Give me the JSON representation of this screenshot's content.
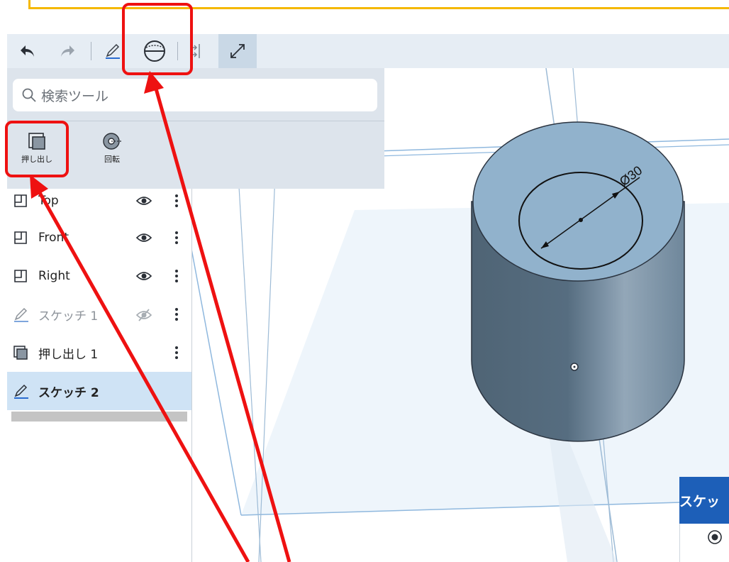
{
  "toolbar": {
    "undo_icon": "undo-icon",
    "redo_icon": "redo-icon",
    "sketch_icon": "pencil-icon",
    "plane_icon": "plane-sphere-icon",
    "mate_icon": "align-icon",
    "view_icon": "expand-arrows-icon"
  },
  "tool_search": {
    "placeholder": "検索ツール"
  },
  "tools": [
    {
      "label": "押し出し",
      "icon": "extrude-icon"
    },
    {
      "label": "回転",
      "icon": "revolve-icon"
    }
  ],
  "features": [
    {
      "name": "Top",
      "icon": "plane-icon",
      "visible": true
    },
    {
      "name": "Front",
      "icon": "plane-icon",
      "visible": true
    },
    {
      "name": "Right",
      "icon": "plane-icon",
      "visible": true
    },
    {
      "name": "スケッチ 1",
      "icon": "pencil-icon",
      "visible": false
    },
    {
      "name": "押し出し 1",
      "icon": "extrude-icon"
    },
    {
      "name": "スケッチ 2",
      "icon": "pencil-icon",
      "selected": true
    }
  ],
  "viewport": {
    "dimension_label": "Ø30"
  },
  "sketch_dialog": {
    "title": "スケッ"
  },
  "colors": {
    "annotation": "#ee1111",
    "callout_border": "#f5b800",
    "dialog_header": "#1d5fb8",
    "selected_row": "#cfe3f5"
  }
}
